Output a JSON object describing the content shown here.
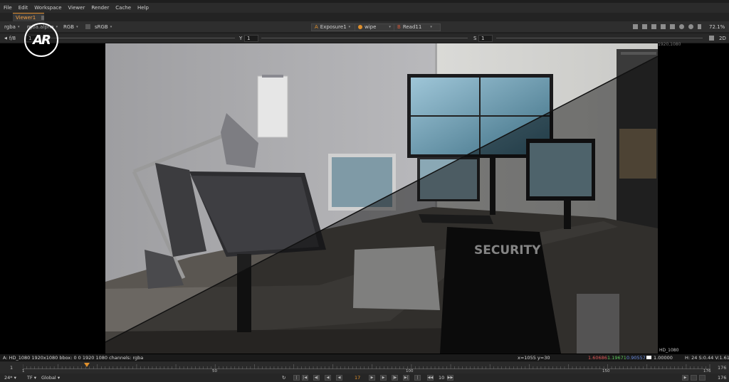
{
  "menu": [
    "File",
    "Edit",
    "Workspace",
    "Viewer",
    "Render",
    "Cache",
    "Help"
  ],
  "tab": {
    "label": "Viewer1"
  },
  "toolbar": {
    "channels": "rgba",
    "alpha_channel": "rgba.alpha",
    "colorspace": "RGB",
    "lut": "sRGB",
    "input_a": {
      "letter": "A",
      "name": "Exposure1",
      "color": "#e0902c"
    },
    "compare": {
      "name": "wipe",
      "color": "#e0902c"
    },
    "input_b": {
      "letter": "B",
      "name": "Read11",
      "color": "#d65a3a"
    },
    "zoom": "72.1%",
    "view_mode": "2D"
  },
  "toolbar2": {
    "fstop": "f/8",
    "gain": "1",
    "y_label": "Y",
    "y_value": "1",
    "s_label": "S",
    "s_value": "1"
  },
  "logo": {
    "text": "AR"
  },
  "viewer": {
    "format_top": "1920,1080",
    "format_bottom": "HD_1080",
    "sign_text": "SECURITY"
  },
  "status": {
    "info": "A:  HD_1080 1920x1080  bbox: 0 0 1920 1080 channels: rgba",
    "coords": "x=1055 y=30",
    "r": "1.60686",
    "g": "1.19671",
    "b": "0.90557",
    "a": "1.00000",
    "hsv": "H: 24 S:0.44 V:1.61",
    "r_color": "#e05a5a",
    "g_color": "#5ec85e",
    "b_color": "#6a8ce0"
  },
  "timeline": {
    "start": "1",
    "end": "176",
    "labels": [
      "1",
      "50",
      "100",
      "150",
      "176"
    ],
    "current_frame": "17",
    "side_left": "1",
    "side_right": "176"
  },
  "bottom": {
    "fps": "24*",
    "tf": "TF",
    "mode": "Global",
    "frame": "17",
    "increment": "10",
    "end_frame": "176"
  }
}
